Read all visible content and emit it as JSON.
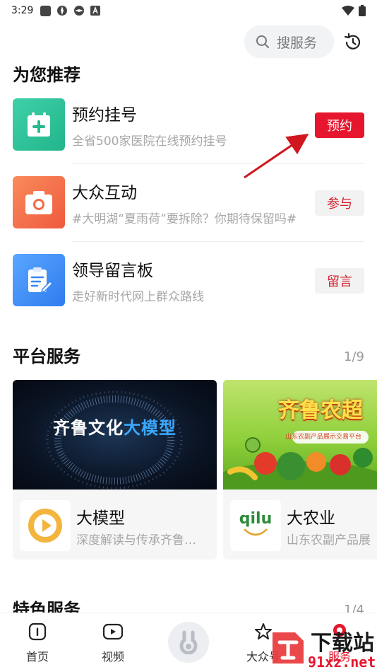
{
  "status": {
    "time": "3:29"
  },
  "search": {
    "placeholder": "搜服务"
  },
  "recommend": {
    "title": "为您推荐",
    "items": [
      {
        "title": "预约挂号",
        "subtitle": "全省500家医院在线预约挂号",
        "button": "预约",
        "color": "#2fbf96"
      },
      {
        "title": "大众互动",
        "subtitle": "#大明湖“夏雨荷”要拆除？你期待保留吗#",
        "button": "参与",
        "color": "#f4764a"
      },
      {
        "title": "领导留言板",
        "subtitle": "走好新时代网上群众路线",
        "button": "留言",
        "color": "#3e8ff0"
      }
    ]
  },
  "platform": {
    "title": "平台服务",
    "pager": "1/9",
    "cards": [
      {
        "banner_text_a": "齐鲁文化",
        "banner_text_b": "大模型",
        "title": "大模型",
        "subtitle": "深度解读与传承齐鲁…"
      },
      {
        "banner_title": "齐鲁农超",
        "banner_sub": "山东农副产品展示交易平台",
        "logo_text": "qilu",
        "title": "大农业",
        "subtitle": "山东农副产品展"
      }
    ]
  },
  "featured": {
    "title": "特色服务",
    "pager": "1/4"
  },
  "tabbar": {
    "items": [
      "首页",
      "视频",
      "大众号",
      "服务"
    ]
  },
  "watermark": {
    "text_a": "下载站",
    "text_b": "91xz.net"
  }
}
